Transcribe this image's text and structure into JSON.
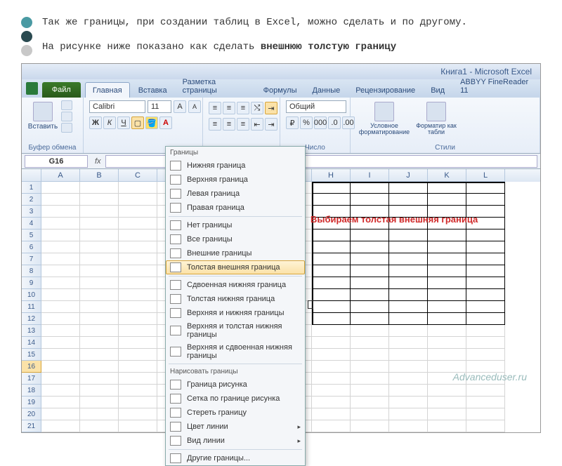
{
  "intro": {
    "line1": "Так же границы, при создании таблиц в Excel, можно сделать и по другому.",
    "line2_prefix": "На рисунке ниже показано как сделать ",
    "line2_bold": "внешнюю толстую границу"
  },
  "titlebar": "Книга1 - Microsoft Excel",
  "tabs": {
    "file": "Файл",
    "items": [
      "Главная",
      "Вставка",
      "Разметка страницы",
      "Формулы",
      "Данные",
      "Рецензирование",
      "Вид",
      "ABBYY FineReader 11"
    ],
    "active_index": 0
  },
  "ribbon": {
    "paste": "Вставить",
    "clipboard_label": "Буфер обмена",
    "font_name": "Calibri",
    "font_size": "11",
    "number_format": "Общий",
    "number_label": "Число",
    "cond_format": "Условное форматирование",
    "format_table": "Форматир как табли",
    "styles_label": "Стили"
  },
  "name_box": "G16",
  "columns": [
    "A",
    "B",
    "C",
    "",
    "",
    "",
    "",
    "H",
    "I",
    "J",
    "K",
    "L"
  ],
  "rows": [
    "1",
    "2",
    "3",
    "4",
    "5",
    "6",
    "7",
    "8",
    "9",
    "10",
    "11",
    "12",
    "13",
    "14",
    "15",
    "16",
    "17",
    "18",
    "19",
    "20",
    "21"
  ],
  "selected_row": "16",
  "borders_menu": {
    "header1": "Границы",
    "items1": [
      "Нижняя граница",
      "Верхняя граница",
      "Левая граница",
      "Правая граница"
    ],
    "items2": [
      "Нет границы",
      "Все границы",
      "Внешние границы",
      "Толстая внешняя граница"
    ],
    "items3": [
      "Сдвоенная нижняя граница",
      "Толстая нижняя граница",
      "Верхняя и нижняя границы",
      "Верхняя и толстая нижняя границы",
      "Верхняя и сдвоенная нижняя границы"
    ],
    "header2": "Нарисовать границы",
    "items4": [
      "Граница рисунка",
      "Сетка по границе рисунка",
      "Стереть границу",
      "Цвет линии",
      "Вид линии"
    ],
    "other": "Другие границы..."
  },
  "callout": "Выбираем толстая внешняя граница",
  "watermark": "Advanceduser.ru"
}
